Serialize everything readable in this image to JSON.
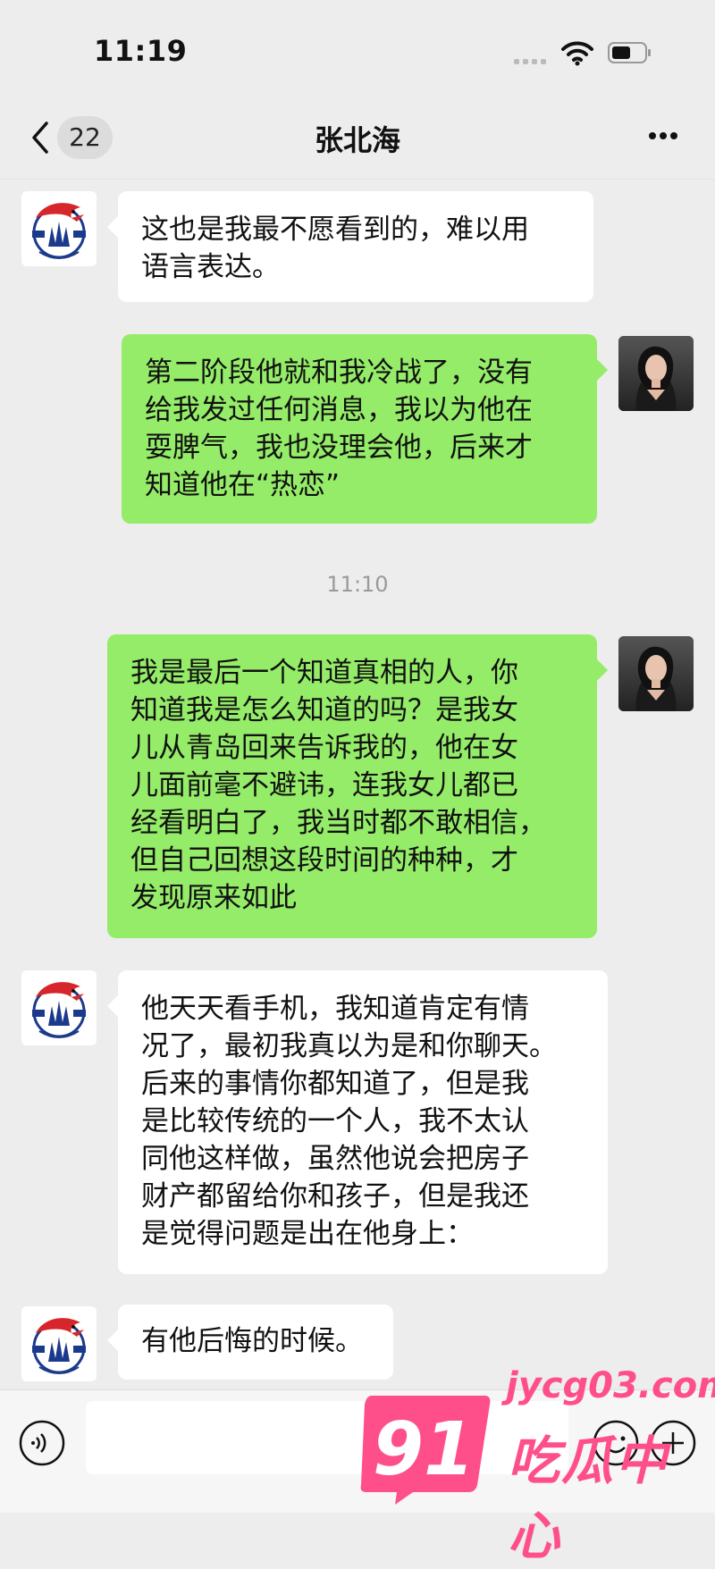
{
  "status_bar": {
    "time": "11:19"
  },
  "nav": {
    "unread_count": "22",
    "title": "张北海"
  },
  "timestamp": "11:10",
  "messages": [
    {
      "side": "in",
      "text": "这也是我最不愿看到的，难以用\n语言表达。"
    },
    {
      "side": "out",
      "text": "第二阶段他就和我冷战了，没有\n给我发过任何消息，我以为他在\n耍脾气，我也没理会他，后来才\n知道他在“热恋”"
    },
    {
      "side": "out",
      "text": "我是最后一个知道真相的人，你\n知道我是怎么知道的吗？是我女\n儿从青岛回来告诉我的，他在女\n儿面前毫不避讳，连我女儿都已\n经看明白了，我当时都不敢相信，\n但自己回想这段时间的种种，才\n发现原来如此"
    },
    {
      "side": "in",
      "text": "他天天看手机，我知道肯定有情\n况了，最初我真以为是和你聊天。\n后来的事情你都知道了，但是我\n是比较传统的一个人，我不太认\n同他这样做，虽然他说会把房子\n财产都留给你和孩子，但是我还\n是觉得问题是出在他身上："
    },
    {
      "side": "in",
      "text": "有他后悔的时候。"
    }
  ],
  "avatar_left": {
    "logo_text": "QINGDAO",
    "side_left": "FC",
    "side_right": "SC"
  },
  "watermark": {
    "number": "91",
    "url": "jycg03.com",
    "brand": "吃瓜中心"
  },
  "colors": {
    "background": "#ededed",
    "outgoing_bubble": "#95ec69",
    "incoming_bubble": "#ffffff",
    "watermark": "#ff4f8b"
  }
}
